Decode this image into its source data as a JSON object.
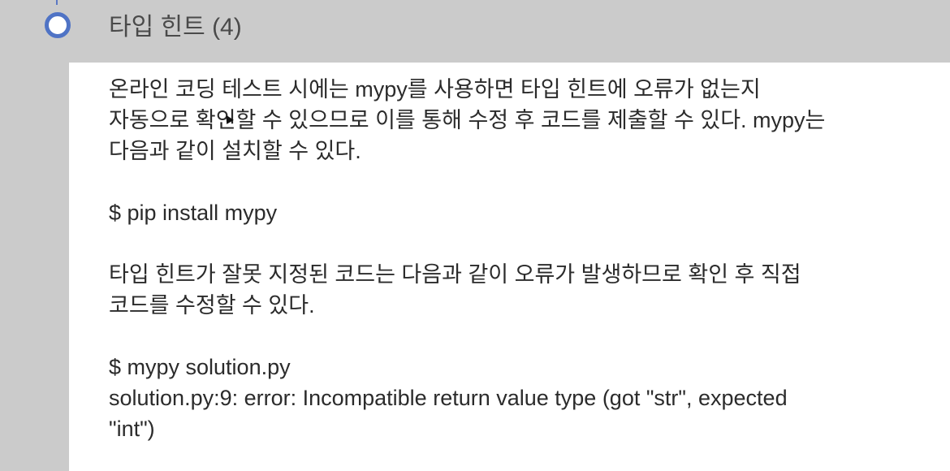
{
  "section": {
    "title": "타입 힌트 (4)"
  },
  "body": {
    "p1": [
      "온라인 코딩 테스트 시에는 mypy를 사용하면 타입 힌트에 오류가 없는지",
      "자동으로 확인할 수 있으므로 이를 통해 수정 후 코드를 제출할 수 있다. mypy는",
      "다음과 같이 설치할 수 있다."
    ],
    "cmd1": "$ pip install mypy",
    "p2": [
      "타입 힌트가 잘못 지정된 코드는 다음과 같이 오류가 발생하므로 확인 후 직접",
      "코드를 수정할 수 있다."
    ],
    "cmd2": "$ mypy solution.py",
    "output": [
      "solution.py:9: error: Incompatible return value type (got \"str\", expected",
      "\"int\")"
    ]
  },
  "colors": {
    "background": "#cbcbcb",
    "panel": "#ffffff",
    "bullet": "#4f73c5",
    "heading": "#4a4a4a",
    "text": "#2b2b2b"
  }
}
